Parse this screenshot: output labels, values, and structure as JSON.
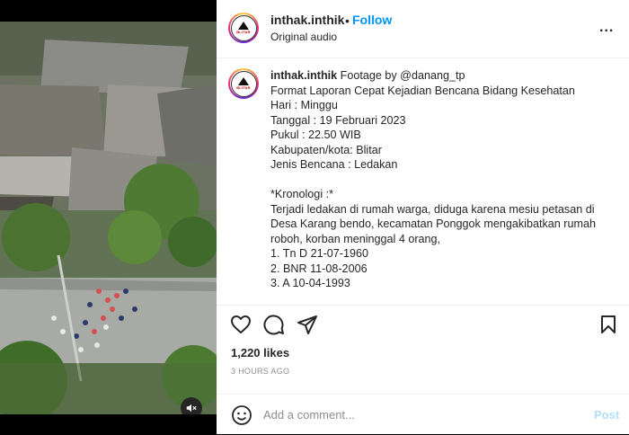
{
  "header": {
    "username": "inthak.inthik",
    "separator": "•",
    "follow_label": "Follow",
    "audio_label": "Original audio",
    "more_label": "...",
    "avatar_text": "BLITAR"
  },
  "caption": {
    "username": "inthak.inthik",
    "lines": [
      "Footage by @danang_tp",
      "Format Laporan Cepat Kejadian Bencana Bidang Kesehatan",
      "Hari : Minggu",
      "Tanggal : 19 Februari 2023",
      "Pukul : 22.50 WIB",
      "Kabupaten/kota: Blitar",
      "Jenis Bencana : Ledakan",
      "",
      "*Kronologi :*",
      "Terjadi ledakan di rumah warga, diduga karena mesiu petasan di",
      "Desa Karang bendo, kecamatan Ponggok mengakibatkan rumah",
      "roboh, korban meninggal 4 orang,",
      "1. Tn D 21-07-1960",
      "2. BNR 11-08-2006",
      "3. A 10-04-1993"
    ]
  },
  "actions": {
    "like_icon": "heart-icon",
    "comment_icon": "comment-icon",
    "share_icon": "share-icon",
    "save_icon": "bookmark-icon"
  },
  "likes": "1,220 likes",
  "time_ago": "3 HOURS AGO",
  "comment": {
    "placeholder": "Add a comment...",
    "post_label": "Post",
    "emoji_icon": "emoji-icon"
  },
  "media": {
    "mute_icon": "muted-speaker-icon"
  },
  "colors": {
    "follow": "#0095f6",
    "post_disabled": "#b2dffc",
    "muted_text": "#8e8e8e"
  }
}
